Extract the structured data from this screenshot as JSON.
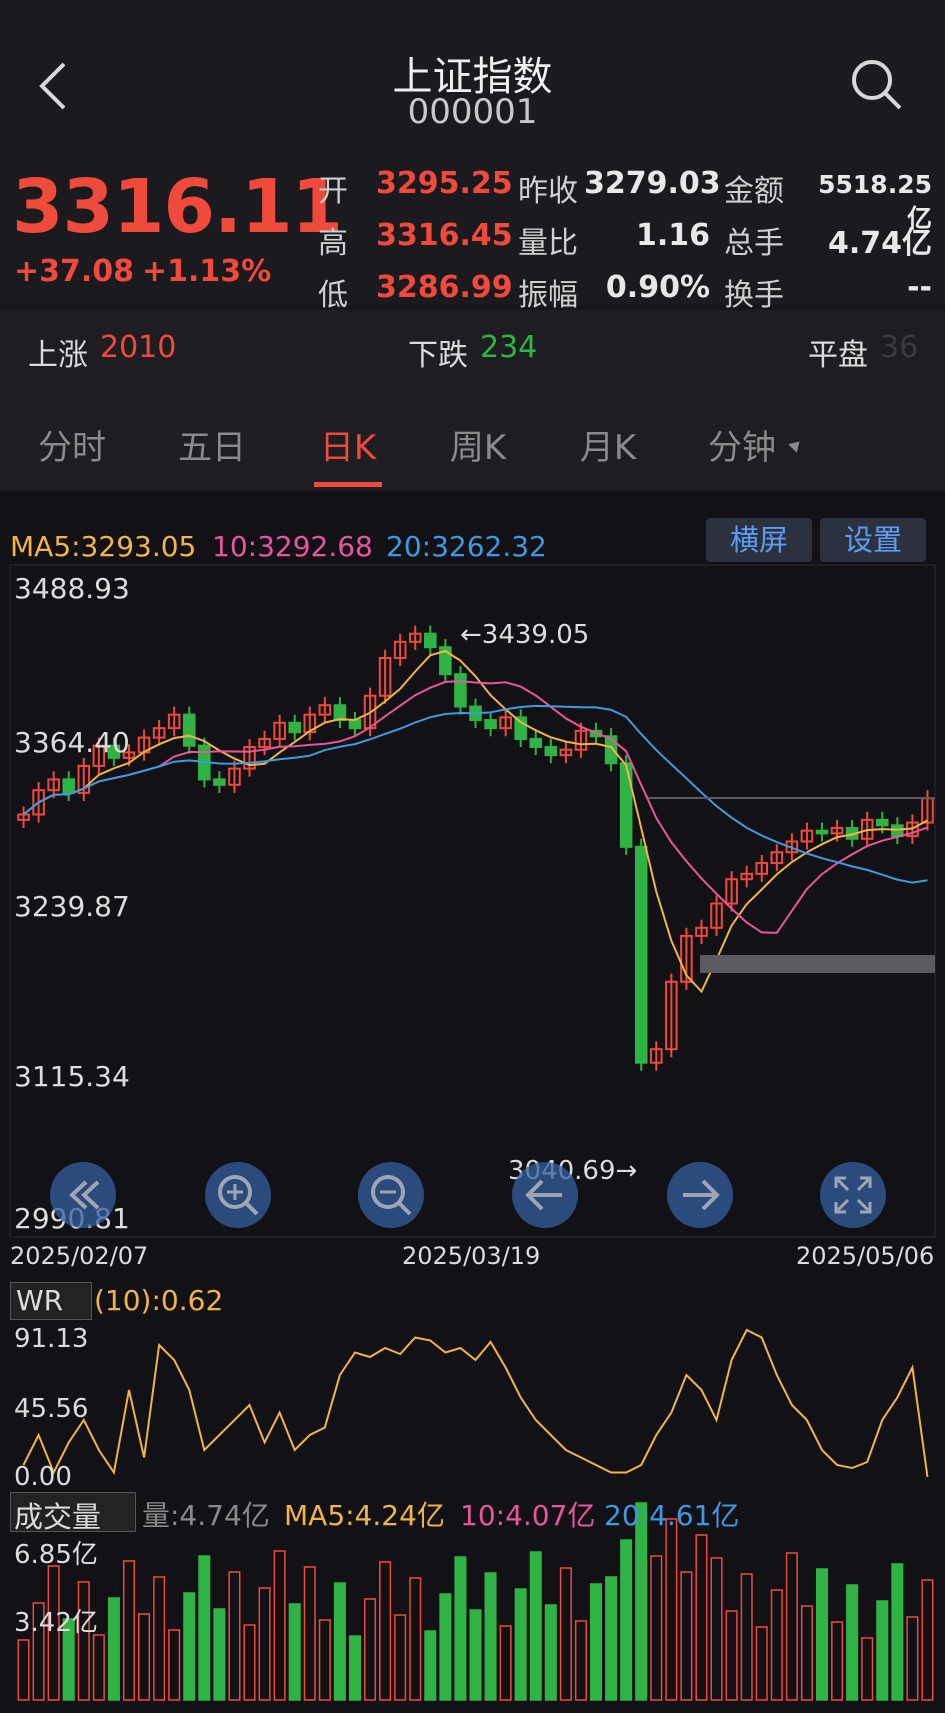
{
  "header": {
    "title": "上证指数",
    "code": "000001",
    "back_icon": "chevron-left-icon",
    "search_icon": "search-icon"
  },
  "quote": {
    "price": "3316.11",
    "change": "+37.08",
    "change_pct": "+1.13%",
    "open_label": "开",
    "open": "3295.25",
    "high_label": "高",
    "high": "3316.45",
    "low_label": "低",
    "low": "3286.99",
    "prev_close_label": "昨收",
    "prev_close": "3279.03",
    "vol_ratio_label": "量比",
    "vol_ratio": "1.16",
    "amplitude_label": "振幅",
    "amplitude": "0.90%",
    "amount_label": "金额",
    "amount": "5518.25亿",
    "total_hands_label": "总手",
    "total_hands": "4.74亿",
    "turnover_label": "换手",
    "turnover": "--"
  },
  "breadth": {
    "up_label": "上涨",
    "up": "2010",
    "down_label": "下跌",
    "down": "234",
    "flat_label": "平盘",
    "flat": "36"
  },
  "tabs": [
    {
      "label": "分时"
    },
    {
      "label": "五日"
    },
    {
      "label": "日K"
    },
    {
      "label": "周K"
    },
    {
      "label": "月K"
    },
    {
      "label": "分钟"
    }
  ],
  "active_tab": "日K",
  "ma_legend": {
    "ma5": "MA5:3293.05",
    "ma10": "10:3292.68",
    "ma20": "20:3262.32"
  },
  "buttons": {
    "landscape": "横屏",
    "settings": "设置"
  },
  "price_axis": [
    "3488.93",
    "3364.40",
    "3239.87",
    "3115.34",
    "2990.81"
  ],
  "date_axis": [
    "2025/02/07",
    "2025/03/19",
    "2025/05/06"
  ],
  "annotations": {
    "high": "←3439.05",
    "low": "3040.69→"
  },
  "wr": {
    "name": "WR",
    "value": "(10):0.62",
    "axis": [
      "91.13",
      "45.56",
      "0.00"
    ]
  },
  "volume": {
    "name": "成交量",
    "vol": "量:4.74亿",
    "ma5": "MA5:4.24亿",
    "ma10": "10:4.07亿",
    "ma20": "20:4.61亿",
    "axis": [
      "6.85亿",
      "3.42亿"
    ]
  },
  "colors": {
    "up": "#f04a3c",
    "down": "#2fb344",
    "ma5": "#f2b34a",
    "ma10": "#e8569a",
    "ma20": "#3d9ae0",
    "accent": "#5d9cf0"
  },
  "controls": [
    {
      "name": "fast-rewind-icon"
    },
    {
      "name": "zoom-in-icon"
    },
    {
      "name": "zoom-out-icon"
    },
    {
      "name": "arrow-left-icon"
    },
    {
      "name": "arrow-right-icon"
    },
    {
      "name": "fullscreen-icon"
    }
  ]
}
